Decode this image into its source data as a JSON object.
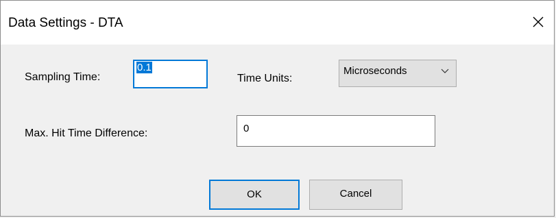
{
  "window": {
    "title": "Data Settings - DTA",
    "close_label": "×"
  },
  "form": {
    "sampling_time_label": "Sampling Time:",
    "sampling_time_value": "0.1",
    "time_units_label": "Time Units:",
    "time_units_value": "Microseconds",
    "max_hit_label": "Max. Hit Time Difference:",
    "max_hit_value": "0"
  },
  "buttons": {
    "ok_label": "OK",
    "cancel_label": "Cancel"
  },
  "colors": {
    "focus_accent": "#0078d7",
    "dialog_bg": "#f0f0f0",
    "titlebar_bg": "#ffffff"
  },
  "icons": {
    "close": "close-icon",
    "dropdown": "chevron-down-icon"
  }
}
